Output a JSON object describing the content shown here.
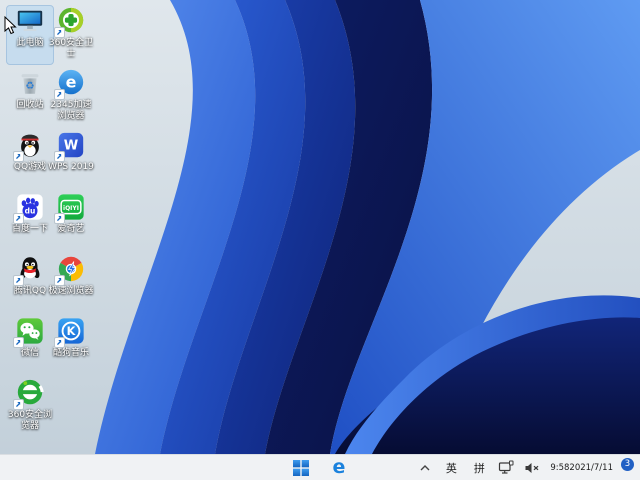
{
  "desktop": {
    "icons": [
      {
        "label": "此电脑",
        "name": "this-pc",
        "selected": true
      },
      {
        "label": "360安全卫士",
        "name": "360-safety-guard"
      },
      {
        "label": "回收站",
        "name": "recycle-bin"
      },
      {
        "label": "2345加速浏览器",
        "name": "2345-browser"
      },
      {
        "label": "QQ游戏",
        "name": "qq-games"
      },
      {
        "label": "WPS 2019",
        "name": "wps-2019"
      },
      {
        "label": "百度一下",
        "name": "baidu-search"
      },
      {
        "label": "爱奇艺",
        "name": "iqiyi"
      },
      {
        "label": "腾讯QQ",
        "name": "tencent-qq"
      },
      {
        "label": "极速浏览器",
        "name": "speed-browser"
      },
      {
        "label": "微信",
        "name": "wechat"
      },
      {
        "label": "酷狗音乐",
        "name": "kugou-music"
      },
      {
        "label": "360安全浏览器",
        "name": "360-safe-browser"
      }
    ]
  },
  "taskbar": {
    "tray": {
      "ime_language": "英",
      "ime_mode": "拼"
    },
    "clock": {
      "time": "9:58",
      "date": "2021/7/11"
    },
    "notification_count": "3"
  },
  "colors": {
    "wallpaper_background": "#d4dee6",
    "wallpaper_blue": "#1f4fc4",
    "taskbar_background": "#f0f2f4",
    "badge_blue": "#2160c4"
  }
}
